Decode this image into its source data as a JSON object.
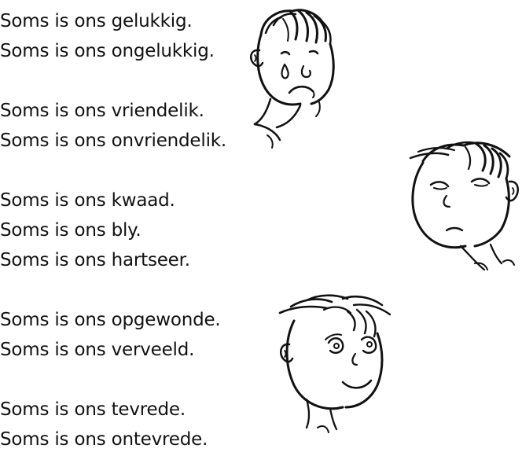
{
  "poem": {
    "stanzas": [
      {
        "lines": [
          "Soms is ons gelukkig.",
          "Soms is ons ongelukkig."
        ]
      },
      {
        "lines": [
          "Soms is ons vriendelik.",
          "Soms is ons onvriendelik."
        ]
      },
      {
        "lines": [
          "Soms is ons kwaad.",
          "Soms is ons bly.",
          "Soms is ons hartseer."
        ]
      },
      {
        "lines": [
          "Soms is ons opgewonde.",
          "Soms is ons verveeld."
        ]
      },
      {
        "lines": [
          "Soms is ons tevrede.",
          "Soms is ons ontevrede."
        ]
      }
    ]
  },
  "illustrations": [
    {
      "icon": "crying-boy-face-icon"
    },
    {
      "icon": "sleepy-boy-face-icon"
    },
    {
      "icon": "smiling-boy-face-icon"
    }
  ],
  "colors": {
    "ink": "#111111",
    "background": "#ffffff"
  }
}
